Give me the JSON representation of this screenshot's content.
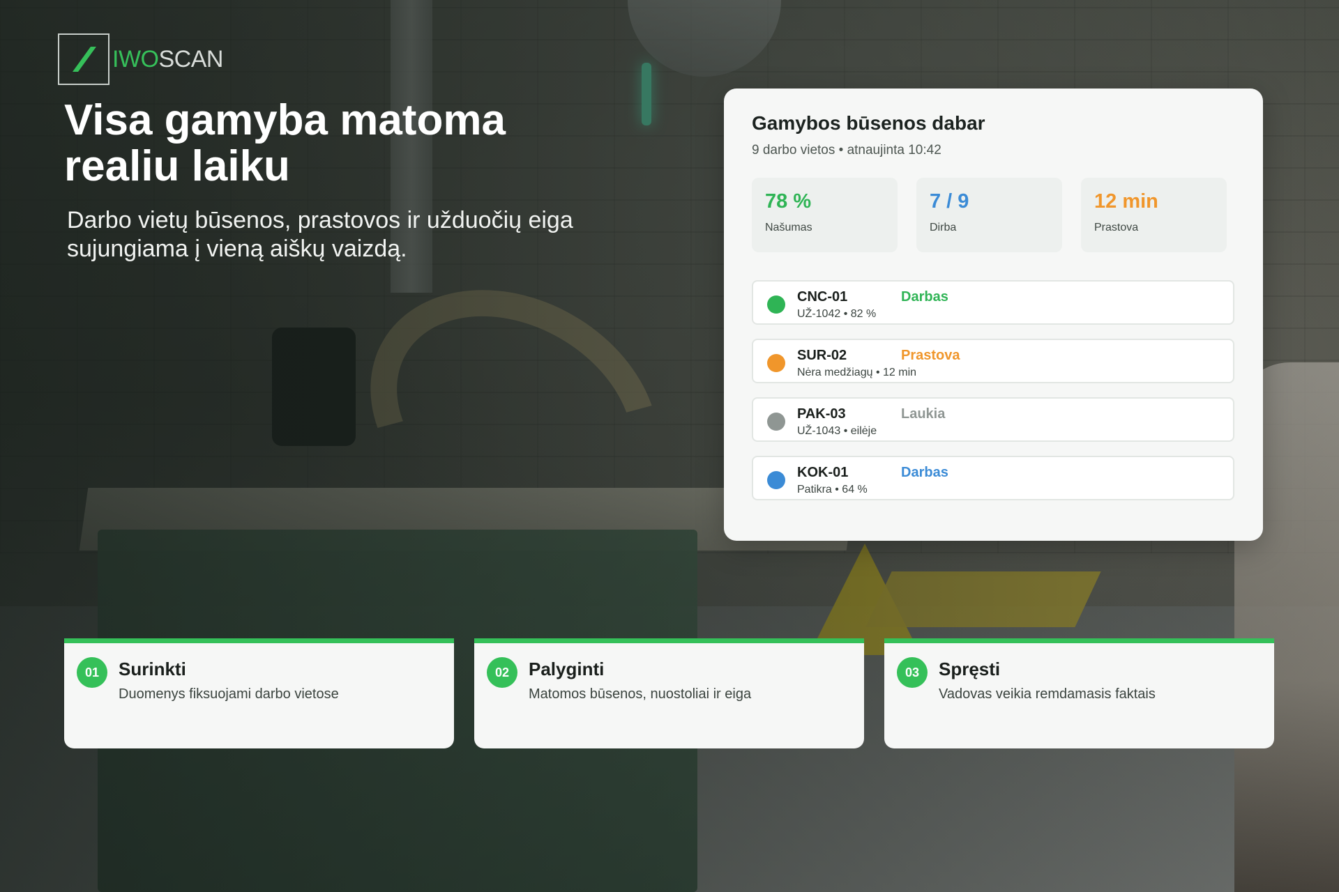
{
  "brand": {
    "part_a": "IWO",
    "part_b": "SCAN",
    "accent": "#36c05a"
  },
  "hero": {
    "title": "Visa gamyba matoma realiu laiku",
    "subtitle": "Darbo vietų būsenos, prastovos ir užduočių eiga sujungiama į vieną aiškų vaizdą."
  },
  "panel": {
    "title": "Gamybos būsenos dabar",
    "subtitle": "9 darbo vietos • atnaujinta 10:42",
    "stats": [
      {
        "value": "78 %",
        "label": "Našumas",
        "color": "#2fb455"
      },
      {
        "value": "7 / 9",
        "label": "Dirba",
        "color": "#3b8bd6"
      },
      {
        "value": "12 min",
        "label": "Prastova",
        "color": "#f0962b"
      }
    ],
    "workstations": [
      {
        "name": "CNC-01",
        "detail": "UŽ-1042 • 82 %",
        "status": "Darbas",
        "color": "#2fb455"
      },
      {
        "name": "SUR-02",
        "detail": "Nėra medžiagų • 12 min",
        "status": "Prastova",
        "color": "#f0962b"
      },
      {
        "name": "PAK-03",
        "detail": "UŽ-1043 • eilėje",
        "status": "Laukia",
        "color": "#8f9693"
      },
      {
        "name": "KOK-01",
        "detail": "Patikra • 64 %",
        "status": "Darbas",
        "color": "#3b8bd6"
      }
    ]
  },
  "steps": [
    {
      "num": "01",
      "title": "Surinkti",
      "desc": "Duomenys fiksuojami darbo vietose"
    },
    {
      "num": "02",
      "title": "Palyginti",
      "desc": "Matomos būsenos, nuostoliai ir eiga"
    },
    {
      "num": "03",
      "title": "Spręsti",
      "desc": "Vadovas veikia remdamasis faktais"
    }
  ]
}
